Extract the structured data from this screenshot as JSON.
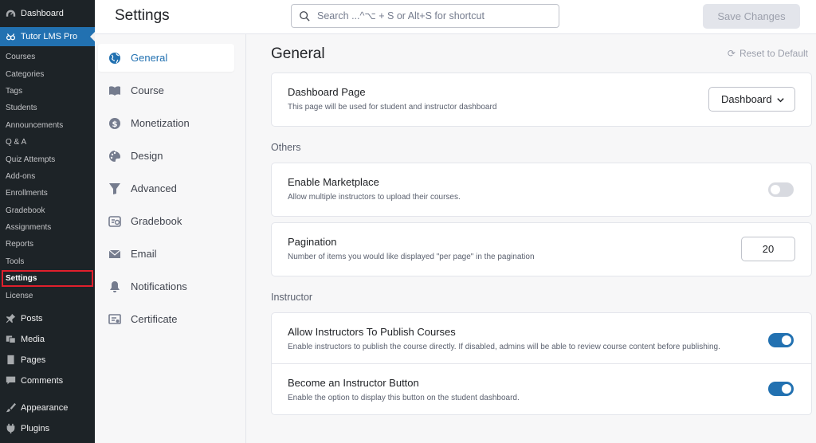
{
  "wp_menu": {
    "dashboard": "Dashboard",
    "tutor": "Tutor LMS Pro",
    "tutor_sub": [
      "Courses",
      "Categories",
      "Tags",
      "Students",
      "Announcements",
      "Q & A",
      "Quiz Attempts",
      "Add-ons",
      "Enrollments",
      "Gradebook",
      "Assignments",
      "Reports",
      "Tools",
      "Settings",
      "License"
    ],
    "current_sub": "Settings",
    "bottom": [
      {
        "label": "Posts",
        "icon": "pin-icon"
      },
      {
        "label": "Media",
        "icon": "media-icon"
      },
      {
        "label": "Pages",
        "icon": "pages-icon"
      },
      {
        "label": "Comments",
        "icon": "comments-icon"
      },
      {
        "label": "Appearance",
        "icon": "brush-icon"
      },
      {
        "label": "Plugins",
        "icon": "plug-icon"
      }
    ]
  },
  "header": {
    "title": "Settings",
    "search_placeholder": "Search ...^⌥ + S or Alt+S for shortcut",
    "save_label": "Save Changes"
  },
  "settings_nav": [
    {
      "label": "General",
      "icon": "globe-icon",
      "active": true
    },
    {
      "label": "Course",
      "icon": "book-icon"
    },
    {
      "label": "Monetization",
      "icon": "dollar-icon"
    },
    {
      "label": "Design",
      "icon": "palette-icon"
    },
    {
      "label": "Advanced",
      "icon": "filter-icon"
    },
    {
      "label": "Gradebook",
      "icon": "gradebook-icon"
    },
    {
      "label": "Email",
      "icon": "envelope-icon"
    },
    {
      "label": "Notifications",
      "icon": "bell-icon"
    },
    {
      "label": "Certificate",
      "icon": "certificate-icon"
    }
  ],
  "main": {
    "title": "General",
    "reset_label": "Reset to Default",
    "dashboard_page": {
      "title": "Dashboard Page",
      "desc": "This page will be used for student and instructor dashboard",
      "selected": "Dashboard"
    },
    "others_label": "Others",
    "marketplace": {
      "title": "Enable Marketplace",
      "desc": "Allow multiple instructors to upload their courses.",
      "enabled": false
    },
    "pagination": {
      "title": "Pagination",
      "desc": "Number of items you would like displayed \"per page\" in the pagination",
      "value": "20"
    },
    "instructor_label": "Instructor",
    "publish_courses": {
      "title": "Allow Instructors To Publish Courses",
      "desc": "Enable instructors to publish the course directly. If disabled, admins will be able to review course content before publishing.",
      "enabled": true
    },
    "instructor_button": {
      "title": "Become an Instructor Button",
      "desc": "Enable the option to display this button on the student dashboard.",
      "enabled": true
    }
  },
  "colors": {
    "accent": "#2271b1",
    "wp_sidebar": "#1d2327",
    "highlight_border": "#e01f2c"
  }
}
